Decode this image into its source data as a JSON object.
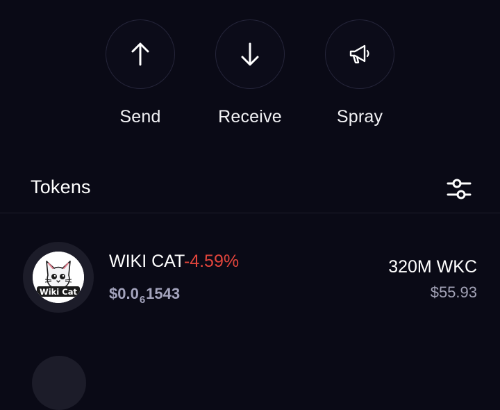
{
  "actions": {
    "send": {
      "label": "Send",
      "icon": "arrow-up-icon"
    },
    "receive": {
      "label": "Receive",
      "icon": "arrow-down-icon"
    },
    "spray": {
      "label": "Spray",
      "icon": "megaphone-icon"
    }
  },
  "tokens": {
    "title": "Tokens",
    "filter_icon": "sliders-icon",
    "items": [
      {
        "name": "WIKI CAT",
        "change": "-4.59%",
        "price_prefix": "$0.0",
        "price_zero_count": "6",
        "price_digits": "1543",
        "amount": "320M WKC",
        "value": "$55.93",
        "logo_text": "Wiki Cat"
      }
    ]
  },
  "colors": {
    "background": "#0a0a16",
    "negative": "#e2453c",
    "muted": "#a2a2b6"
  }
}
